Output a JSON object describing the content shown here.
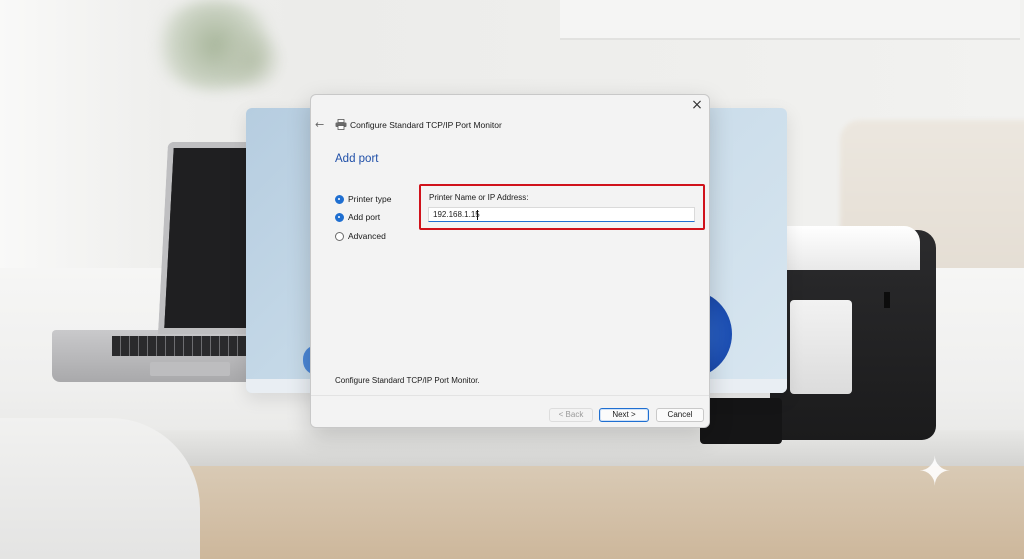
{
  "dialog": {
    "title": "Configure Standard TCP/IP Port Monitor",
    "heading": "Add port",
    "close_glyph": "×",
    "back_glyph": "←",
    "steps": [
      {
        "label": "Printer type",
        "checked": true
      },
      {
        "label": "Add port",
        "checked": true
      },
      {
        "label": "Advanced",
        "checked": false
      }
    ],
    "field": {
      "label": "Printer Name or IP Address:",
      "value": "192.168.1.15"
    },
    "footer_text": "Configure Standard TCP/IP Port Monitor.",
    "buttons": {
      "back": "< Back",
      "next": "Next >",
      "cancel": "Cancel"
    }
  },
  "background": {
    "sparkle_glyph": "✦"
  },
  "colors": {
    "accent": "#1f6fd1",
    "heading": "#1f4fa8",
    "highlight": "#d0121b"
  }
}
